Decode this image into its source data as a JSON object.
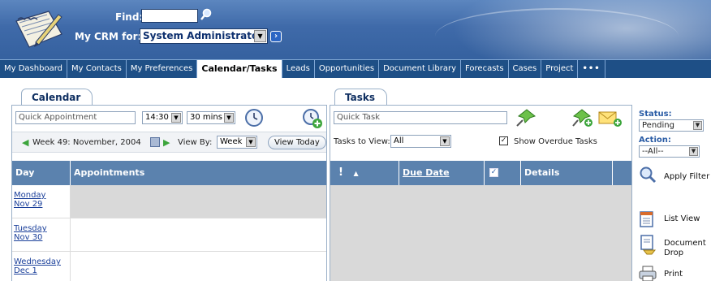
{
  "header": {
    "find_label": "Find:",
    "crm_for_label": "My CRM for:",
    "crm_user": "System Administrator"
  },
  "nav": {
    "tabs": [
      {
        "label": "My Dashboard"
      },
      {
        "label": "My Contacts"
      },
      {
        "label": "My Preferences"
      },
      {
        "label": "Calendar/Tasks",
        "active": true
      },
      {
        "label": "Leads"
      },
      {
        "label": "Opportunities"
      },
      {
        "label": "Document Library"
      },
      {
        "label": "Forecasts"
      },
      {
        "label": "Cases"
      },
      {
        "label": "Project"
      },
      {
        "label": "•••"
      }
    ]
  },
  "calendar": {
    "title": "Calendar",
    "quick_appointment_placeholder": "Quick Appointment",
    "time_value": "14:30",
    "duration_value": "30 mins",
    "week_label": "Week 49: November, 2004",
    "view_by_label": "View By:",
    "view_by_value": "Week",
    "view_today_label": "View Today",
    "columns": {
      "day": "Day",
      "appointments": "Appointments"
    },
    "days": [
      {
        "day": "Monday",
        "date": "Nov 29"
      },
      {
        "day": "Tuesday",
        "date": "Nov 30"
      },
      {
        "day": "Wednesday",
        "date": "Dec 1"
      }
    ]
  },
  "tasks": {
    "title": "Tasks",
    "quick_task_placeholder": "Quick Task",
    "tasks_to_view_label": "Tasks to View:",
    "tasks_to_view_value": "All",
    "show_overdue_label": "Show Overdue Tasks",
    "show_overdue_checked": true,
    "columns": {
      "priority": "!",
      "due_date": "Due Date",
      "details": "Details"
    }
  },
  "side": {
    "status_label": "Status:",
    "status_value": "Pending",
    "action_label": "Action:",
    "action_value": "--All--",
    "apply_filter_label": "Apply Filter",
    "list_view_label": "List View",
    "document_drop_label": "Document Drop",
    "print_label": "Print"
  },
  "colors": {
    "header_blue": "#3f6aa9",
    "nav_blue": "#1e4f86",
    "grid_header": "#5b82ae",
    "link_blue": "#1a3f9a"
  }
}
